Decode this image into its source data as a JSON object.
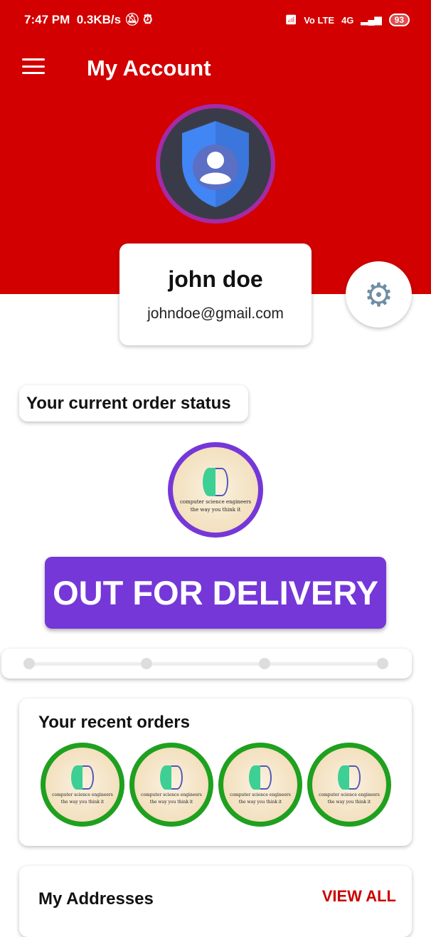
{
  "status_bar": {
    "time": "7:47 PM",
    "speed": "0.3KB/s",
    "network": "4G",
    "volte": "Vo LTE",
    "battery": "93"
  },
  "header": {
    "title": "My Account",
    "bg_color": "#d20000"
  },
  "profile": {
    "name": "john doe",
    "email": "johndoe@gmail.com"
  },
  "order_status": {
    "label": "Your current order status",
    "status": "OUT FOR DELIVERY",
    "status_color": "#7537d8",
    "progress_steps": 4,
    "current_step": 0
  },
  "logo": {
    "line1": "computer science engineers",
    "line2": "the way you think it"
  },
  "recent_orders": {
    "title": "Your recent orders",
    "count": 4,
    "ring_color": "#1fa01f"
  },
  "addresses": {
    "title": "My Addresses",
    "view_all": "VIEW ALL"
  }
}
